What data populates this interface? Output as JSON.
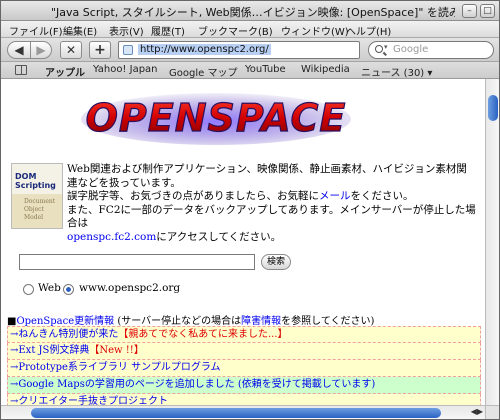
{
  "window": {
    "title": "\"Java Script, スタイルシート, Web関係…イビジョン映像: [OpenSpace]\" を読み込み中"
  },
  "menu": [
    "ファイル(F)",
    "編集(E)",
    "表示(V)",
    "履歴(T)",
    "ブックマーク(B)",
    "ウィンドウ(W)",
    "ヘルプ(H)"
  ],
  "toolbar": {
    "back": "◀",
    "forward": "▶",
    "stop": "✕",
    "add": "+",
    "url": "http://www.openspc2.org/",
    "search_placeholder": "Google"
  },
  "bookmarks": [
    "アップル",
    "Yahoo! Japan",
    "Google マップ",
    "YouTube",
    "Wikipedia",
    "ニュース (30) ▾"
  ],
  "logo": {
    "text": "OPENSPACE"
  },
  "book": {
    "title": "DOM Scripting",
    "sub": "Document Object Model"
  },
  "intro": {
    "line1": "Web関連および制作アプリケーション、映像関係、静止画素材、ハイビジョン素材関連などを扱っています。",
    "line2_pre": "誤字脱字等、お気づきの点がありましたら、お気軽に",
    "line2_link": "メール",
    "line2_post": "をください。",
    "line3": "また、FC2に一部のデータをバックアップしてあります。メインサーバーが停止した場合は",
    "line4_link": "openspc.fc2.com",
    "line4_post": "にアクセスしてください。"
  },
  "search": {
    "button": "検索"
  },
  "radios": [
    {
      "label": "Web"
    },
    {
      "label": "www.openspc2.org"
    }
  ],
  "notice": {
    "prefix": "■",
    "link1": "OpenSpace更新情報",
    "mid": " (サーバー停止などの場合は",
    "link2": "障害情報",
    "post": "を参照してください)"
  },
  "news": [
    {
      "text": "→ねんきん特別便が来た",
      "extra": "【親あてでなく私あてに来ました...】",
      "bg": "yellow"
    },
    {
      "text": "→Ext JS例文辞典",
      "extra": "【New !!】",
      "bg": "yellow"
    },
    {
      "text": "→Prototype系ライブラリ サンプルプログラム",
      "extra": "",
      "bg": "yellow"
    },
    {
      "text": "→Google Mapsの学習用のページを追加しました (依頼を受けて掲載しています)",
      "extra": "",
      "bg": "green"
    },
    {
      "text": "→クリエイター手抜きプロジェクト",
      "extra": "",
      "bg": "yellow"
    }
  ]
}
